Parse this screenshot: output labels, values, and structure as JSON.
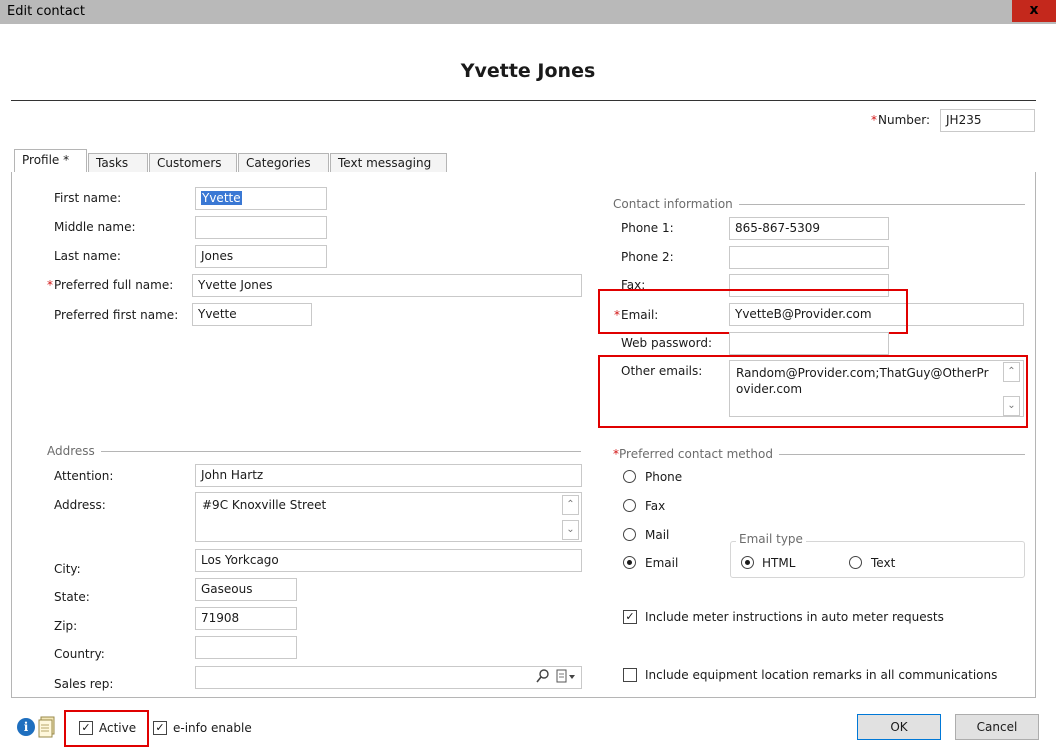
{
  "window": {
    "title": "Edit contact",
    "close_glyph": "x"
  },
  "header": {
    "contact_name": "Yvette Jones",
    "number_required": "*",
    "number_label": "Number:",
    "number_value": "JH235"
  },
  "tabs": [
    {
      "label": "Profile *",
      "active": true
    },
    {
      "label": "Tasks",
      "active": false
    },
    {
      "label": "Customers",
      "active": false
    },
    {
      "label": "Categories",
      "active": false
    },
    {
      "label": "Text messaging",
      "active": false
    }
  ],
  "name_fields": {
    "first_name_label": "First name:",
    "first_name_value": "Yvette",
    "middle_name_label": "Middle name:",
    "middle_name_value": "",
    "last_name_label": "Last name:",
    "last_name_value": "Jones",
    "preferred_full_required": "*",
    "preferred_full_label": "Preferred full name:",
    "preferred_full_value": "Yvette Jones",
    "preferred_first_label": "Preferred first name:",
    "preferred_first_value": "Yvette"
  },
  "contact_info": {
    "group_title": "Contact information",
    "phone1_label": "Phone 1:",
    "phone1_value": "865-867-5309",
    "phone2_label": "Phone 2:",
    "phone2_value": "",
    "fax_label": "Fax:",
    "fax_value": "",
    "email_required": "*",
    "email_label": "Email:",
    "email_value": "YvetteB@Provider.com",
    "web_password_label": "Web password:",
    "web_password_value": "",
    "other_emails_label": "Other emails:",
    "other_emails_value": "Random@Provider.com;ThatGuy@OtherProvider.com"
  },
  "address": {
    "group_title": "Address",
    "attention_label": "Attention:",
    "attention_value": "John Hartz",
    "address_label": "Address:",
    "address_value": "#9C Knoxville Street",
    "city_label": "City:",
    "city_value": "Los Yorkcago",
    "state_label": "State:",
    "state_value": "Gaseous",
    "zip_label": "Zip:",
    "zip_value": "71908",
    "country_label": "Country:",
    "country_value": "",
    "sales_rep_label": "Sales rep:",
    "sales_rep_value": ""
  },
  "preferred_contact": {
    "required": "*",
    "group_title": "Preferred contact method",
    "options": [
      {
        "label": "Phone",
        "selected": false
      },
      {
        "label": "Fax",
        "selected": false
      },
      {
        "label": "Mail",
        "selected": false
      },
      {
        "label": "Email",
        "selected": true
      }
    ],
    "email_type_title": "Email type",
    "email_type_options": [
      {
        "label": "HTML",
        "selected": true
      },
      {
        "label": "Text",
        "selected": false
      }
    ]
  },
  "checkboxes": {
    "meter_instructions": {
      "label": "Include meter instructions in auto meter requests",
      "checked": true
    },
    "equipment_remarks": {
      "label": "Include equipment location remarks in all communications",
      "checked": false
    }
  },
  "footer": {
    "active": {
      "label": "Active",
      "checked": true
    },
    "einfo": {
      "label": "e-info enable",
      "checked": true
    },
    "ok_label": "OK",
    "cancel_label": "Cancel"
  },
  "icons": {
    "info": "info-icon",
    "notes": "notes-icon",
    "search": "magnifier-icon",
    "lookup": "lookup-dropdown-icon"
  },
  "colors": {
    "highlight_box": "#e00000",
    "required_asterisk": "#d21414",
    "selection": "#3a78d4",
    "ok_border": "#0078d7"
  }
}
